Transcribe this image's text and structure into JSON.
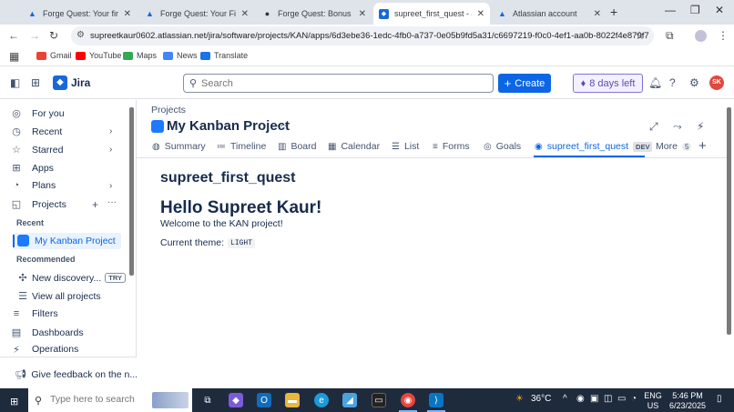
{
  "browser": {
    "tabs": [
      {
        "title": "Forge Quest: Your first q",
        "active": false
      },
      {
        "title": "Forge Quest: Your First O",
        "active": false
      },
      {
        "title": "Forge Quest: Bonus Level",
        "active": false
      },
      {
        "title": "supreet_first_quest - Jira",
        "active": true
      },
      {
        "title": "Atlassian account",
        "active": false
      }
    ],
    "url": "supreetkaur0602.atlassian.net/jira/software/projects/KAN/apps/6d3ebe36-1edc-4fb0-a737-0e05b9fd5a31/c6697219-f0c0-4ef1-aa0b-8022f4e879f7",
    "bookmarks": [
      "Gmail",
      "YouTube",
      "Maps",
      "News",
      "Translate"
    ]
  },
  "jira": {
    "product_name": "Jira",
    "search_placeholder": "Search",
    "create_label": "Create",
    "trial_label": "8 days left",
    "avatar_initials": "SK"
  },
  "sidebar": {
    "items": [
      {
        "label": "For you"
      },
      {
        "label": "Recent"
      },
      {
        "label": "Starred"
      },
      {
        "label": "Apps"
      },
      {
        "label": "Plans"
      },
      {
        "label": "Projects"
      }
    ],
    "recent_heading": "Recent",
    "recent_project": "My Kanban Project",
    "recommended_heading": "Recommended",
    "recommended_item": "New discovery...",
    "try_badge": "TRY",
    "view_all": "View all projects",
    "filters": "Filters",
    "dashboards": "Dashboards",
    "operations": "Operations",
    "feedback": "Give feedback on the n..."
  },
  "project": {
    "breadcrumb": "Projects",
    "title": "My Kanban Project",
    "tabs": [
      {
        "label": "Summary"
      },
      {
        "label": "Timeline"
      },
      {
        "label": "Board"
      },
      {
        "label": "Calendar"
      },
      {
        "label": "List"
      },
      {
        "label": "Forms"
      },
      {
        "label": "Goals"
      },
      {
        "label": "supreet_first_quest"
      }
    ],
    "active_tab_badge": "DEV",
    "more_label": "More",
    "more_count": "5"
  },
  "app": {
    "title": "supreet_first_quest",
    "greeting": "Hello Supreet Kaur!",
    "welcome": "Welcome to the KAN project!",
    "theme_label": "Current theme:",
    "theme_value": "LIGHT"
  },
  "taskbar": {
    "search_placeholder": "Type here to search",
    "weather": "36°C",
    "lang_top": "ENG",
    "lang_bottom": "US",
    "time": "5:46 PM",
    "date": "6/23/2025"
  },
  "colors": {
    "accent": "#0c66e4",
    "trial": "#5e4db2",
    "avatar": "#e2483d"
  }
}
